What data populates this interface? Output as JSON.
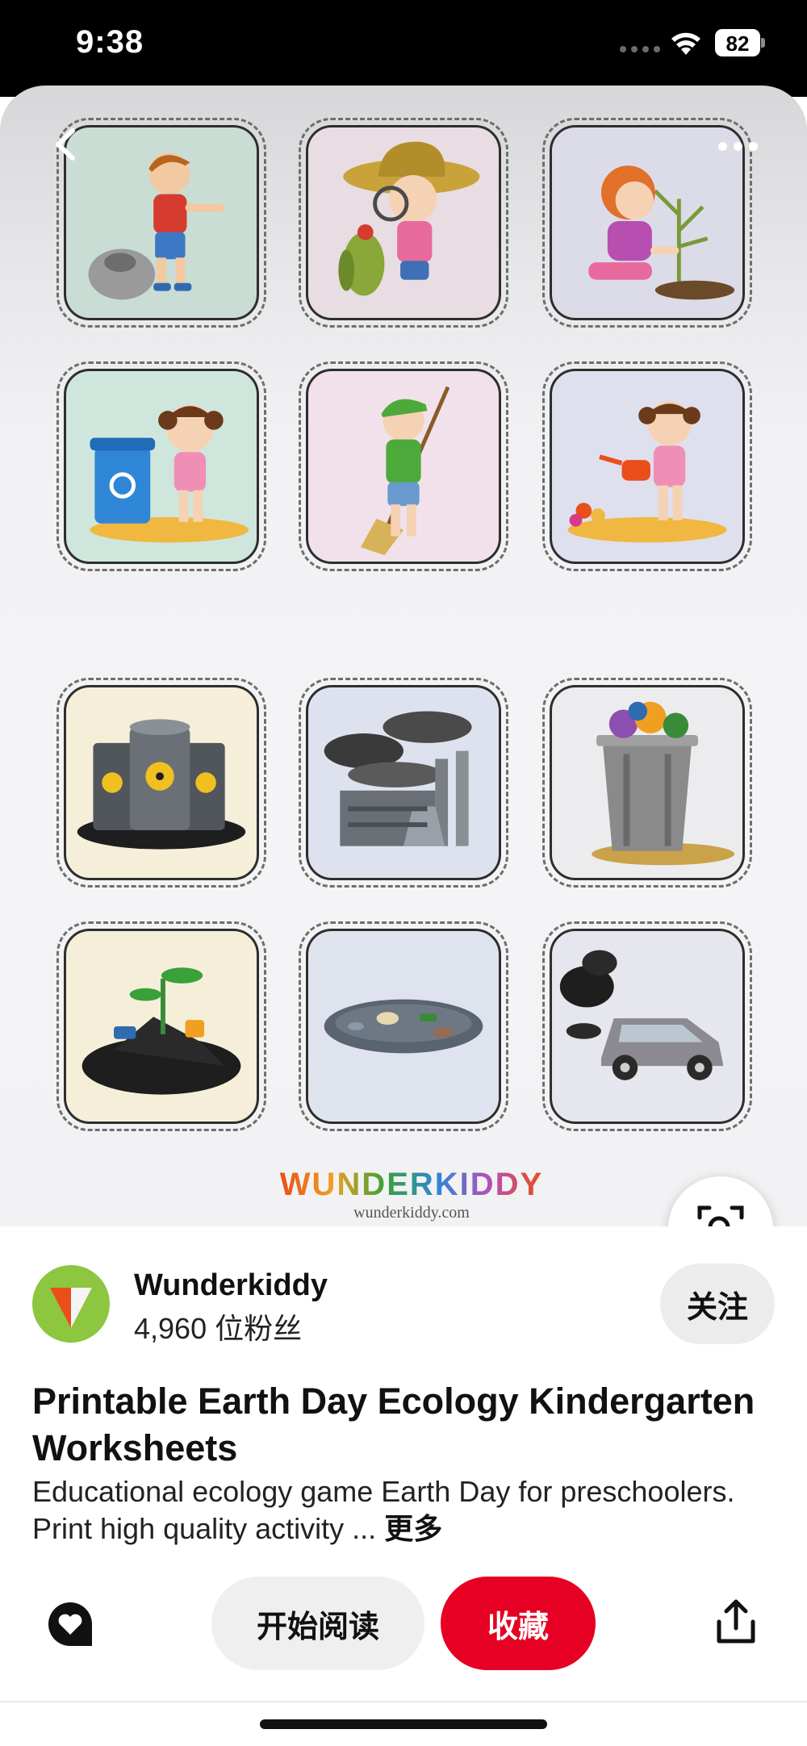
{
  "status_bar": {
    "time": "9:38",
    "battery": "82"
  },
  "pin": {
    "brand": "WUNDERKIDDY",
    "brand_url": "wunderkiddy.com",
    "cards": [
      {
        "name": "boy-picking-up-trash"
      },
      {
        "name": "girl-with-magnifier"
      },
      {
        "name": "girl-planting-tree"
      },
      {
        "name": "girl-recycling"
      },
      {
        "name": "boy-sweeping"
      },
      {
        "name": "girl-watering-flowers"
      },
      {
        "name": "toxic-barrels"
      },
      {
        "name": "factory-smoke"
      },
      {
        "name": "overflowing-trash-can"
      },
      {
        "name": "sprout-in-oil-waste"
      },
      {
        "name": "polluted-water"
      },
      {
        "name": "car-exhaust"
      }
    ]
  },
  "creator": {
    "name": "Wunderkiddy",
    "followers": "4,960 位粉丝",
    "follow_label": "关注"
  },
  "title": "Printable Earth Day Ecology Kindergarten Worksheets",
  "description": "Educational ecology game Earth Day for preschoolers. Print high quality activity ...",
  "more_label": "更多",
  "actions": {
    "read_label": "开始阅读",
    "save_label": "收藏"
  },
  "colors": {
    "save": "#e60023",
    "avatar_bg": "#8dc63f",
    "logo_accent": "#e94e1b"
  },
  "icons": [
    "back-icon",
    "more-icon",
    "visual-search-icon",
    "heart-comment-icon",
    "share-icon"
  ]
}
